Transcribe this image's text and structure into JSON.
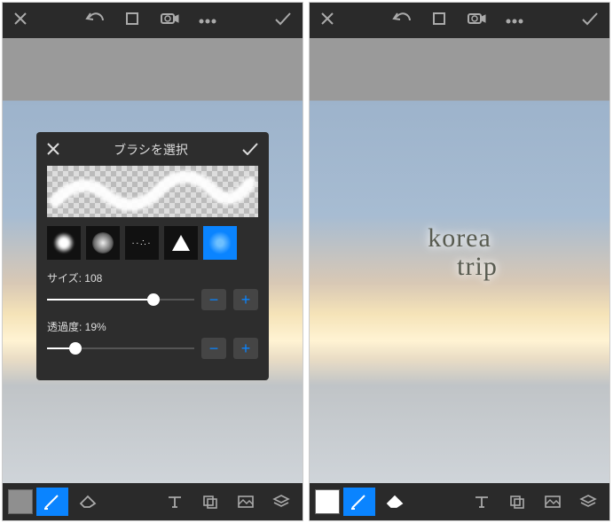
{
  "topbar": {
    "close": "close-icon",
    "undo": "undo-icon",
    "crop": "crop-icon",
    "camera": "camera-icon",
    "more": "more-icon",
    "confirm": "check-icon"
  },
  "brush_picker": {
    "title": "ブラシを選択",
    "size_label": "サイズ: 108",
    "size_value": 108,
    "size_pct": 72,
    "opacity_label": "透過度: 19%",
    "opacity_value": 19,
    "opacity_pct": 19,
    "brushes": [
      "cloud",
      "spray",
      "dots",
      "triangle",
      "soft"
    ],
    "selected_brush": "soft",
    "minus": "−",
    "plus": "+"
  },
  "right_text": {
    "line1": "korea",
    "line2": "trip"
  },
  "bottombar": {
    "swatch_left": "#8f8f8f",
    "swatch_right": "#ffffff",
    "tools": [
      "brush",
      "eraser",
      "text",
      "transform",
      "image",
      "layers"
    ]
  }
}
